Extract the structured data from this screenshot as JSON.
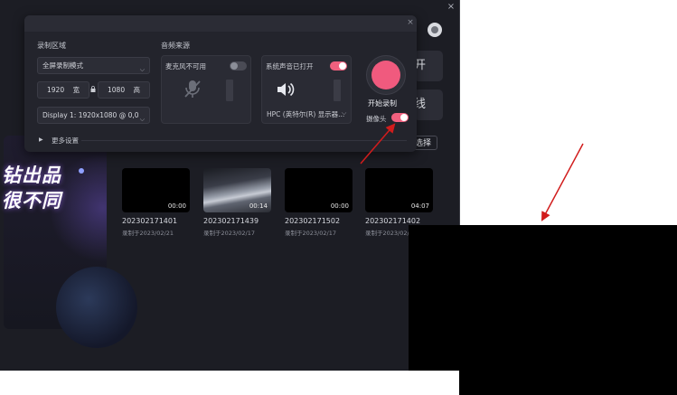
{
  "window": {
    "close_glyph": "×"
  },
  "background_app": {
    "promo_line1": "钻出品",
    "promo_line2": "很不同",
    "side_button_1": "开",
    "side_button_2": "线",
    "side_button_3": "选择"
  },
  "recordings": [
    {
      "name": "202302171401",
      "date": "录制于2023/02/21",
      "duration": "00:00"
    },
    {
      "name": "202302171439",
      "date": "录制于2023/02/17",
      "duration": "00:14"
    },
    {
      "name": "202302171502",
      "date": "录制于2023/02/17",
      "duration": "00:00"
    },
    {
      "name": "202302171402",
      "date": "录制于2023/02/17",
      "duration": "04:07"
    }
  ],
  "dialog": {
    "close_glyph": "×",
    "region": {
      "title": "录制区域",
      "mode": "全屏录制模式",
      "width": "1920",
      "width_unit": "宽",
      "height": "1080",
      "height_unit": "高",
      "display": "Display 1: 1920x1080 @ 0,0"
    },
    "audio": {
      "title": "音频来源",
      "mic_label": "麦克风不可用",
      "mic_enabled": false,
      "system_label": "系统声音已打开",
      "system_enabled": true,
      "device": "HPC (英特尔(R) 显示器..."
    },
    "record": {
      "label": "开始录制",
      "camera_label": "摄像头",
      "camera_enabled": true
    },
    "more_settings": "更多设置"
  },
  "colors": {
    "accent": "#f0607e",
    "panel": "#23242c",
    "background": "#1c1d24",
    "arrow": "#d11c1c"
  },
  "icons": {
    "mic": "mic-off-icon",
    "speaker": "speaker-icon",
    "lock": "lock-icon",
    "chevron": "chevron-down-icon",
    "close": "close-icon"
  }
}
